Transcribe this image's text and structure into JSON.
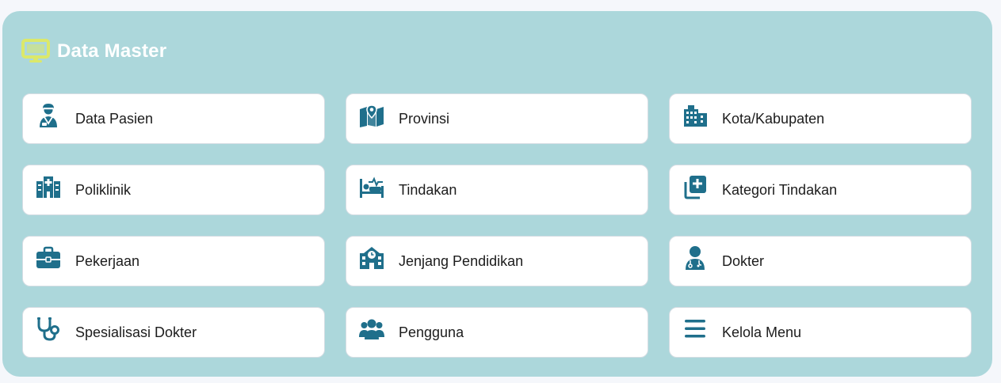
{
  "header": {
    "title": "Data Master",
    "icon": "monitor-icon",
    "icon_color": "#dbe86a"
  },
  "colors": {
    "panel_bg": "#acd7db",
    "card_bg": "#ffffff",
    "icon": "#1f6f8b",
    "text": "#1c1c1c"
  },
  "menu": {
    "items": [
      {
        "label": "Data Pasien",
        "icon": "patient-icon"
      },
      {
        "label": "Provinsi",
        "icon": "map-icon"
      },
      {
        "label": "Kota/Kabupaten",
        "icon": "city-icon"
      },
      {
        "label": "Poliklinik",
        "icon": "hospital-icon"
      },
      {
        "label": "Tindakan",
        "icon": "bed-pulse-icon"
      },
      {
        "label": "Kategori Tindakan",
        "icon": "medical-files-icon"
      },
      {
        "label": "Pekerjaan",
        "icon": "briefcase-icon"
      },
      {
        "label": "Jenjang Pendidikan",
        "icon": "school-icon"
      },
      {
        "label": "Dokter",
        "icon": "doctor-icon"
      },
      {
        "label": "Spesialisasi Dokter",
        "icon": "stethoscope-icon"
      },
      {
        "label": "Pengguna",
        "icon": "users-icon"
      },
      {
        "label": "Kelola Menu",
        "icon": "bars-icon"
      }
    ]
  }
}
